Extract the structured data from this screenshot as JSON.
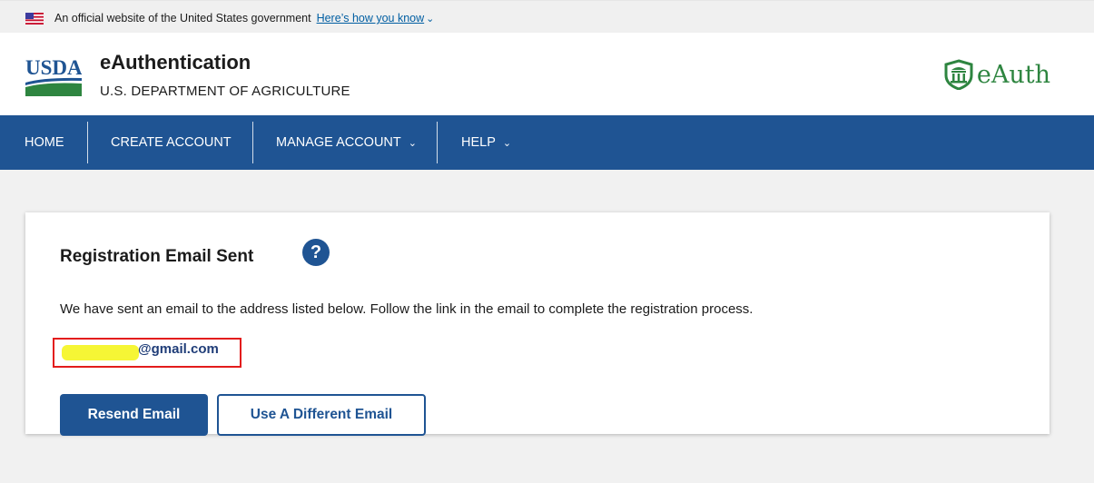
{
  "gov_banner": {
    "text": "An official website of the United States government",
    "link": "Here’s how you know",
    "chevron": "⌄"
  },
  "header": {
    "logo_text": "USDA",
    "title": "eAuthentication",
    "subtitle": "U.S. DEPARTMENT OF AGRICULTURE",
    "brand_logo_text": "eAuth",
    "brand_color": "#2e8540"
  },
  "nav": {
    "items": [
      {
        "label": "HOME"
      },
      {
        "label": "CREATE ACCOUNT"
      },
      {
        "label": "MANAGE ACCOUNT",
        "chevron": "⌄"
      },
      {
        "label": "HELP",
        "chevron": "⌄"
      }
    ],
    "background": "#1f5493"
  },
  "card": {
    "title": "Registration Email Sent",
    "help_icon": "?",
    "description": "We have sent an email to the address listed below. Follow the link in the email to complete the registration process.",
    "email": "@gmail.com",
    "resend_button": "Resend Email",
    "different_email_button": "Use A Different Email"
  },
  "colors": {
    "primary": "#1f5493",
    "highlight_border": "#e31c1c",
    "redaction": "#f5f52a"
  }
}
